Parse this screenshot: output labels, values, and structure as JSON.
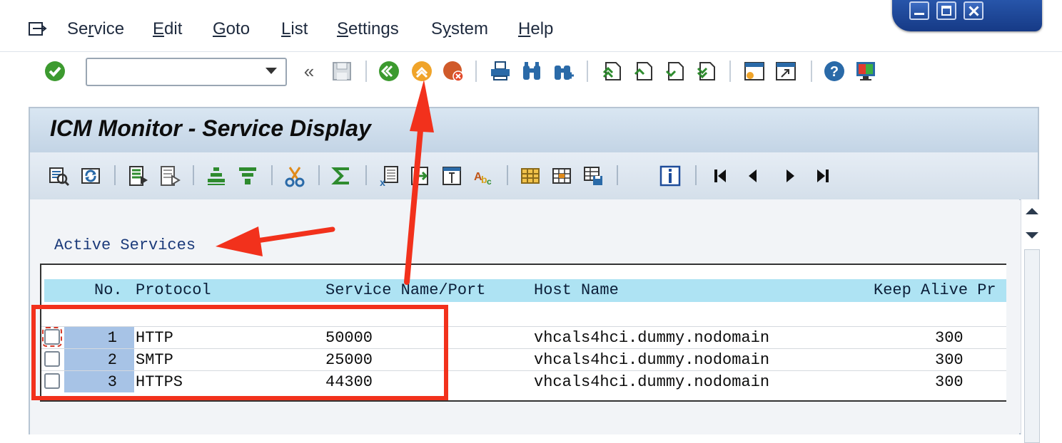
{
  "menu": {
    "items": [
      {
        "label": "Service",
        "access_index": 2
      },
      {
        "label": "Edit",
        "access_index": 0
      },
      {
        "label": "Goto",
        "access_index": 0
      },
      {
        "label": "List",
        "access_index": 0
      },
      {
        "label": "Settings",
        "access_index": 0
      },
      {
        "label": "System",
        "access_index": 1
      },
      {
        "label": "Help",
        "access_index": 0
      }
    ]
  },
  "toolbar": {
    "command_field_value": "",
    "back_chevrons": "«",
    "icons": [
      "enter-icon",
      "save-icon",
      "back-icon",
      "exit-icon",
      "cancel-icon",
      "print-icon",
      "find-icon",
      "find-next-icon",
      "first-page-icon",
      "prev-page-icon",
      "next-page-icon",
      "last-page-icon",
      "new-session-icon",
      "shortcut-icon",
      "help-icon",
      "customize-layout-icon"
    ]
  },
  "page": {
    "title": "ICM Monitor - Service Display"
  },
  "app_toolbar": {
    "icons": [
      "details-icon",
      "refresh-icon",
      "select-all-icon",
      "deselect-all-icon",
      "sort-ascending-icon",
      "filter-icon",
      "cut-icon",
      "sum-icon",
      "export-excel-icon",
      "export-icon",
      "print-preview-icon",
      "abc-analysis-icon",
      "choose-layout-icon",
      "change-layout-icon",
      "save-layout-icon",
      "info-icon",
      "first-row-icon",
      "previous-row-icon",
      "next-row-icon",
      "last-row-icon"
    ]
  },
  "section": {
    "title": "Active Services"
  },
  "table": {
    "columns": [
      "No.",
      "Protocol",
      "Service Name/Port",
      "Host Name",
      "Keep Alive Pr"
    ],
    "rows": [
      {
        "no": "1",
        "protocol": "HTTP",
        "port": "50000",
        "host": "vhcals4hci.dummy.nodomain",
        "keep_alive": "300"
      },
      {
        "no": "2",
        "protocol": "SMTP",
        "port": "25000",
        "host": "vhcals4hci.dummy.nodomain",
        "keep_alive": "300"
      },
      {
        "no": "3",
        "protocol": "HTTPS",
        "port": "44300",
        "host": "vhcals4hci.dummy.nodomain",
        "keep_alive": "300"
      }
    ]
  },
  "colors": {
    "annotation": "#f2311c",
    "header_bg": "#aee3f3",
    "number_cell_bg": "#a7c3e6",
    "title_bar": "#c3d4e5"
  }
}
